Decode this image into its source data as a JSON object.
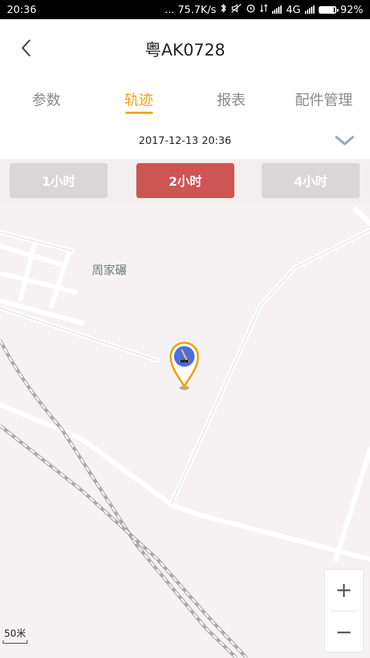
{
  "status": {
    "time": "20:36",
    "net_speed": "... 75.7K/s",
    "network_type": "4G",
    "battery_percent": "92%",
    "battery_level": 0.92,
    "icons": [
      "bluetooth-icon",
      "mute-icon",
      "alarm-icon",
      "data-icon",
      "signal-icon",
      "battery-icon"
    ]
  },
  "header": {
    "back_icon": "chevron-left-icon",
    "title": "粤AK0728"
  },
  "tabs": [
    {
      "label": "参数",
      "active": false
    },
    {
      "label": "轨迹",
      "active": true
    },
    {
      "label": "报表",
      "active": false
    },
    {
      "label": "配件管理",
      "active": false
    }
  ],
  "date_row": {
    "datetime": "2017-12-13 20:36",
    "dropdown_icon": "chevron-down-icon"
  },
  "durations": [
    {
      "label": "1小时",
      "active": false
    },
    {
      "label": "2小时",
      "active": true
    },
    {
      "label": "4小时",
      "active": false
    }
  ],
  "map": {
    "place_label": "周家碾",
    "marker_icon": "location-pin-icon",
    "zoom_in_label": "+",
    "zoom_out_label": "−",
    "scale_label": "50米"
  },
  "colors": {
    "accent": "#f0a30a",
    "active_duration": "#cd5553",
    "inactive_duration": "#d9d6d7",
    "map_bg": "#f6f2f3",
    "marker_blue": "#4a6ee0"
  }
}
